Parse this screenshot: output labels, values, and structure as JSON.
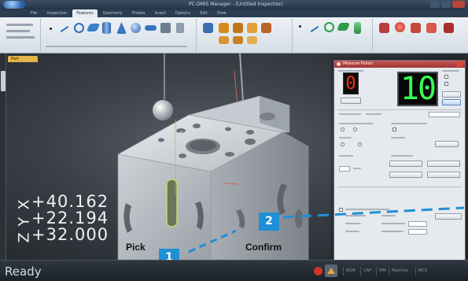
{
  "window": {
    "title": "PC-DMIS Manager - [Untitled Inspection]",
    "accent_color": "#1f8fd6"
  },
  "ribbon": {
    "tabs": [
      "File",
      "Inspection",
      "Features",
      "Geometry",
      "Probes",
      "Insert",
      "Options",
      "Edit",
      "View"
    ],
    "active_tab": "Features",
    "tools": [
      "Point",
      "Line",
      "Circle",
      "Plane",
      "Cylinder",
      "Cone",
      "Sphere",
      "Slot",
      "Contour"
    ]
  },
  "viewport": {
    "doc_tab": "Part",
    "dro": [
      {
        "axis": "X",
        "value": "+40.162"
      },
      {
        "axis": "Y",
        "value": "+22.194"
      },
      {
        "axis": "Z",
        "value": "+32.000"
      }
    ]
  },
  "dialog": {
    "title": "Measure Points",
    "hits_taken": "0",
    "hits_total": "10",
    "buttons": [
      "Done",
      "Cancel",
      "Undo",
      "Clear"
    ]
  },
  "status": {
    "text": "Ready",
    "cells": [
      "NUM",
      "CAP",
      "MM",
      "Machine",
      "MCS"
    ]
  },
  "callouts": [
    {
      "number": "1",
      "label": "Pick"
    },
    {
      "number": "2",
      "label": "Confirm"
    }
  ]
}
